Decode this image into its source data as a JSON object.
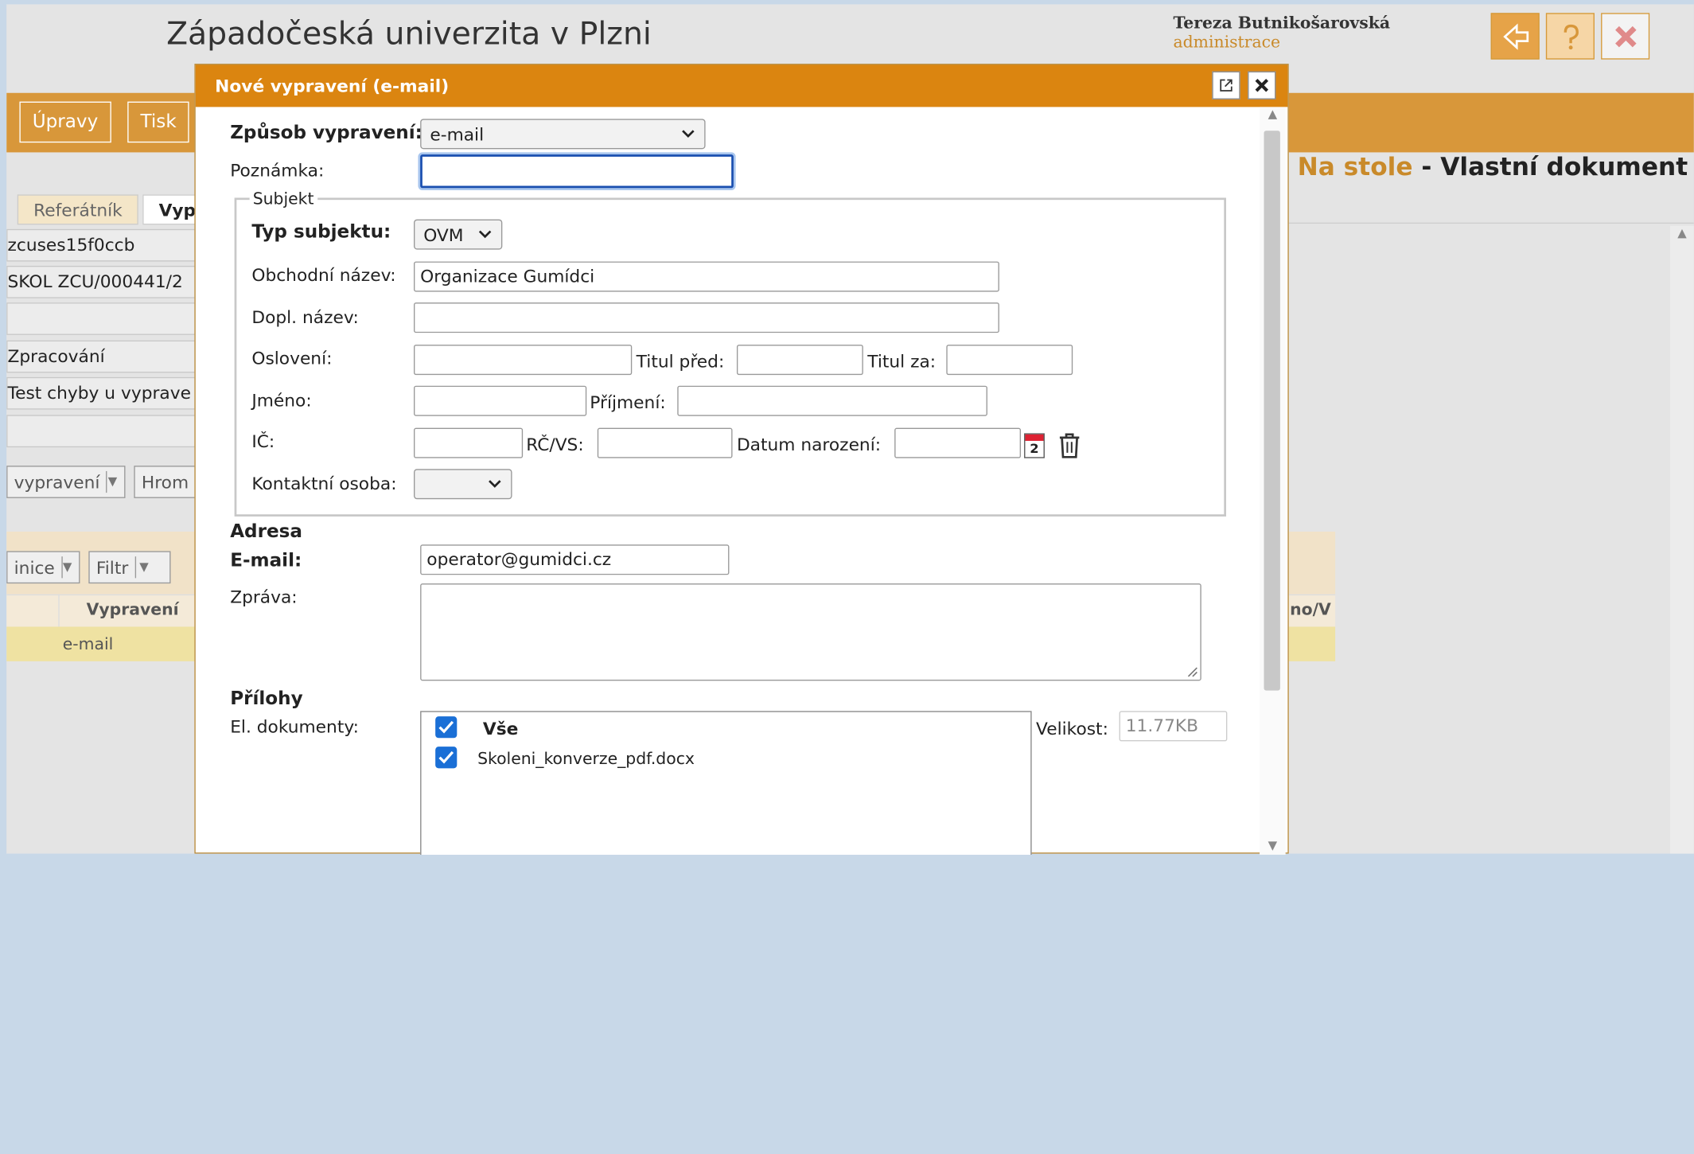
{
  "header": {
    "university": "Západočeská univerzita v Plzni",
    "user_name": "Tereza  Butnikošarovská",
    "user_role": "administrace"
  },
  "toolbar": {
    "edit_label": "Úpravy",
    "print_label": "Tisk"
  },
  "document_heading": {
    "place": "Na stole",
    "separator": " - ",
    "title": "Vlastní dokument"
  },
  "background": {
    "tabs": [
      "Referátník",
      "Vyp"
    ],
    "fields": [
      "zcuses15f0ccb",
      "SKOL ZCU/000441/2",
      "",
      "Zpracování",
      "Test chyby u vyprave",
      ""
    ],
    "chip_dispatch": "vypravení",
    "chip_bulk": "Hrom",
    "chip_definition": "inice",
    "chip_filter": "Filtr",
    "table_header": "Vypravení",
    "table_header_right": "no/V",
    "table_cell": "e-mail"
  },
  "modal": {
    "title": "Nové vypravení (e-mail)",
    "method_label": "Způsob vypravení:",
    "method_value": "e-mail",
    "note_label": "Poznámka:",
    "note_value": "",
    "subject_legend": "Subjekt",
    "subject_type_label": "Typ subjektu:",
    "subject_type_value": "OVM",
    "company_label": "Obchodní název:",
    "company_value": "Organizace Gumídci",
    "extra_name_label": "Dopl. název:",
    "extra_name_value": "",
    "salutation_label": "Oslovení:",
    "title_before_label": "Titul před:",
    "title_after_label": "Titul za:",
    "first_name_label": "Jméno:",
    "last_name_label": "Příjmení:",
    "ic_label": "IČ:",
    "rc_label": "RČ/VS:",
    "birth_label": "Datum narození:",
    "calendar_badge": "2",
    "contact_label": "Kontaktní osoba:",
    "address_heading": "Adresa",
    "email_label": "E-mail:",
    "email_value": "operator@gumidci.cz",
    "message_label": "Zpráva:",
    "attachments_heading": "Přílohy",
    "edocs_label": "El. dokumenty:",
    "all_label": "Vše",
    "file_name": "Skoleni_konverze_pdf.docx",
    "size_label": "Velikost:",
    "size_value": "11.77KB"
  },
  "colors": {
    "accent": "#db8510",
    "bar": "#d8973a",
    "checkbox": "#1a6fd6"
  }
}
